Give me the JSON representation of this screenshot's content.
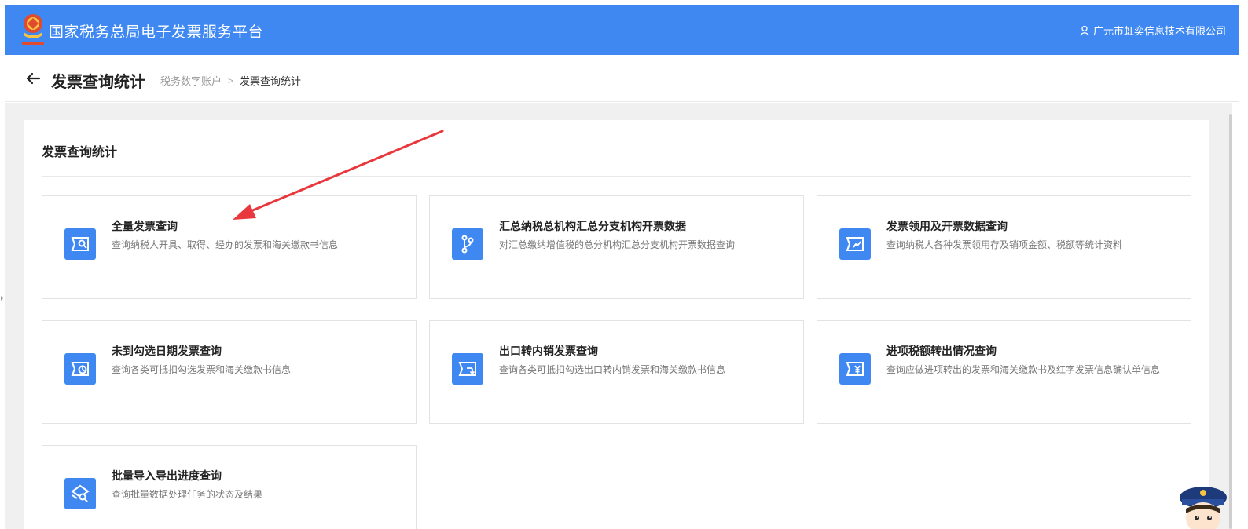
{
  "header": {
    "site_title": "国家税务总局电子发票服务平台",
    "user_name": "广元市虹奕信息技术有限公司"
  },
  "subheader": {
    "page_title": "发票查询统计",
    "breadcrumb": [
      "税务数字账户",
      "发票查询统计"
    ],
    "breadcrumb_sep": ">"
  },
  "panel": {
    "title": "发票查询统计",
    "cards": [
      {
        "title": "全量发票查询",
        "desc": "查询纳税人开具、取得、经办的发票和海关缴款书信息",
        "icon": "full-invoice-query-icon"
      },
      {
        "title": "汇总纳税总机构汇总分支机构开票数据",
        "desc": "对汇总缴纳增值税的总分机构汇总分支机构开票数据查询",
        "icon": "branch-merge-icon"
      },
      {
        "title": "发票领用及开票数据查询",
        "desc": "查询纳税人各种发票领用存及销项金额、税额等统计资料",
        "icon": "invoice-trend-icon"
      },
      {
        "title": "未到勾选日期发票查询",
        "desc": "查询各类可抵扣勾选发票和海关缴款书信息",
        "icon": "invoice-clock-icon"
      },
      {
        "title": "出口转内销发票查询",
        "desc": "查询各类可抵扣勾选出口转内销发票和海关缴款书信息",
        "icon": "invoice-return-icon"
      },
      {
        "title": "进项税额转出情况查询",
        "desc": "查询应做进项转出的发票和海关缴款书及红字发票信息确认单信息",
        "icon": "invoice-yen-icon"
      },
      {
        "title": "批量导入导出进度查询",
        "desc": "查询批量数据处理任务的状态及结果",
        "icon": "batch-progress-icon"
      }
    ]
  },
  "colors": {
    "brand_blue": "#3f88f2",
    "annotation_red": "#e8383d"
  }
}
